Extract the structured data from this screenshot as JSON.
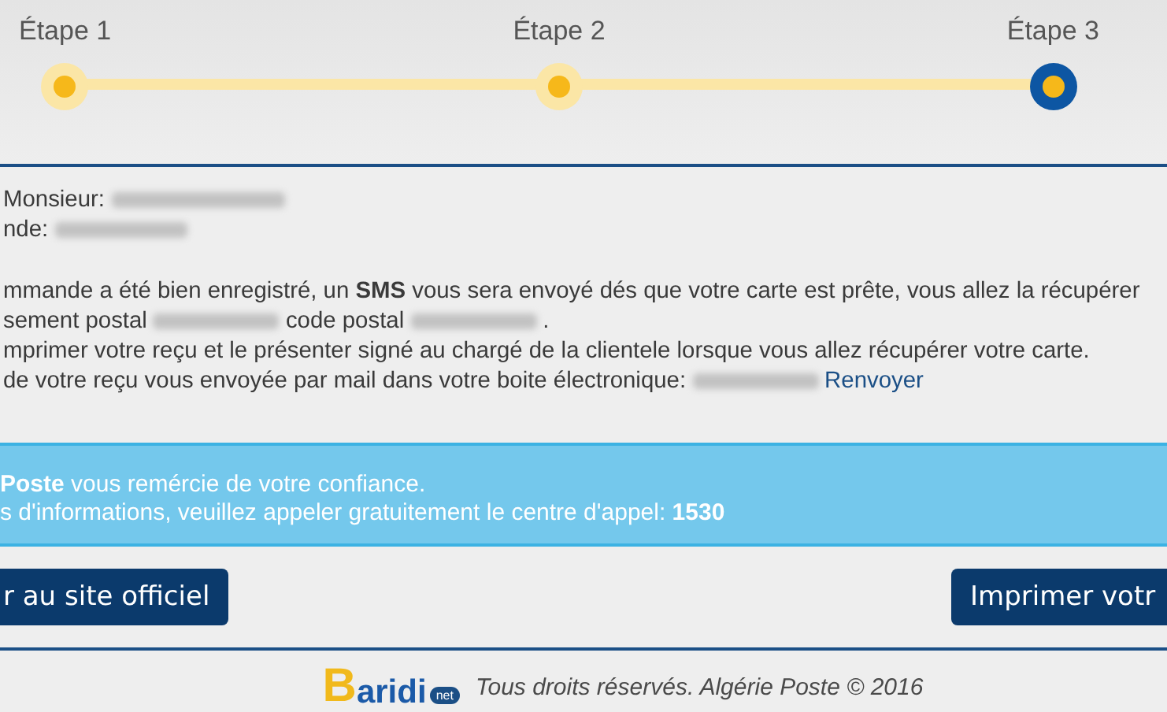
{
  "steps": [
    {
      "label": "Étape 1",
      "selected": false
    },
    {
      "label": "Étape 2",
      "selected": false
    },
    {
      "label": "Étape 3",
      "selected": true
    }
  ],
  "details": [
    [
      {
        "kind": "text",
        "text": "Monsieur:"
      },
      {
        "kind": "redacted"
      }
    ],
    [
      {
        "kind": "text",
        "text": "nde:"
      },
      {
        "kind": "redacted"
      }
    ],
    [
      {
        "kind": "text",
        "text": "mmande a été bien enregistré, un **SMS** vous sera envoyé dés que votre carte est prête, vous allez la récupérer"
      }
    ],
    [
      {
        "kind": "text",
        "text": "sement postal"
      },
      {
        "kind": "redacted"
      },
      {
        "kind": "text",
        "text": "code postal"
      },
      {
        "kind": "redacted"
      },
      {
        "kind": "text",
        "text": "."
      }
    ],
    [
      {
        "kind": "text",
        "text": "mprimer votre reçu et le présenter signé au chargé de la clientele lorsque vous allez récupérer votre carte."
      }
    ],
    [
      {
        "kind": "text",
        "text": "de votre reçu vous envoyée par mail dans votre boite électronique:"
      },
      {
        "kind": "redacted"
      },
      {
        "kind": "link",
        "text": "Renvoyer"
      }
    ]
  ],
  "notice": [
    "**Poste** vous remércie de votre confiance.",
    "s d'informations, veuillez appeler gratuitement le centre d'appel: **1530**"
  ],
  "buttons": [
    "r au site officiel",
    "Imprimer votr"
  ],
  "footer": {
    "logo": {
      "letter": "B",
      "rest": "aridi",
      "badge": "net"
    },
    "text": "Tous droits réservés. Algérie Poste © 2016"
  }
}
